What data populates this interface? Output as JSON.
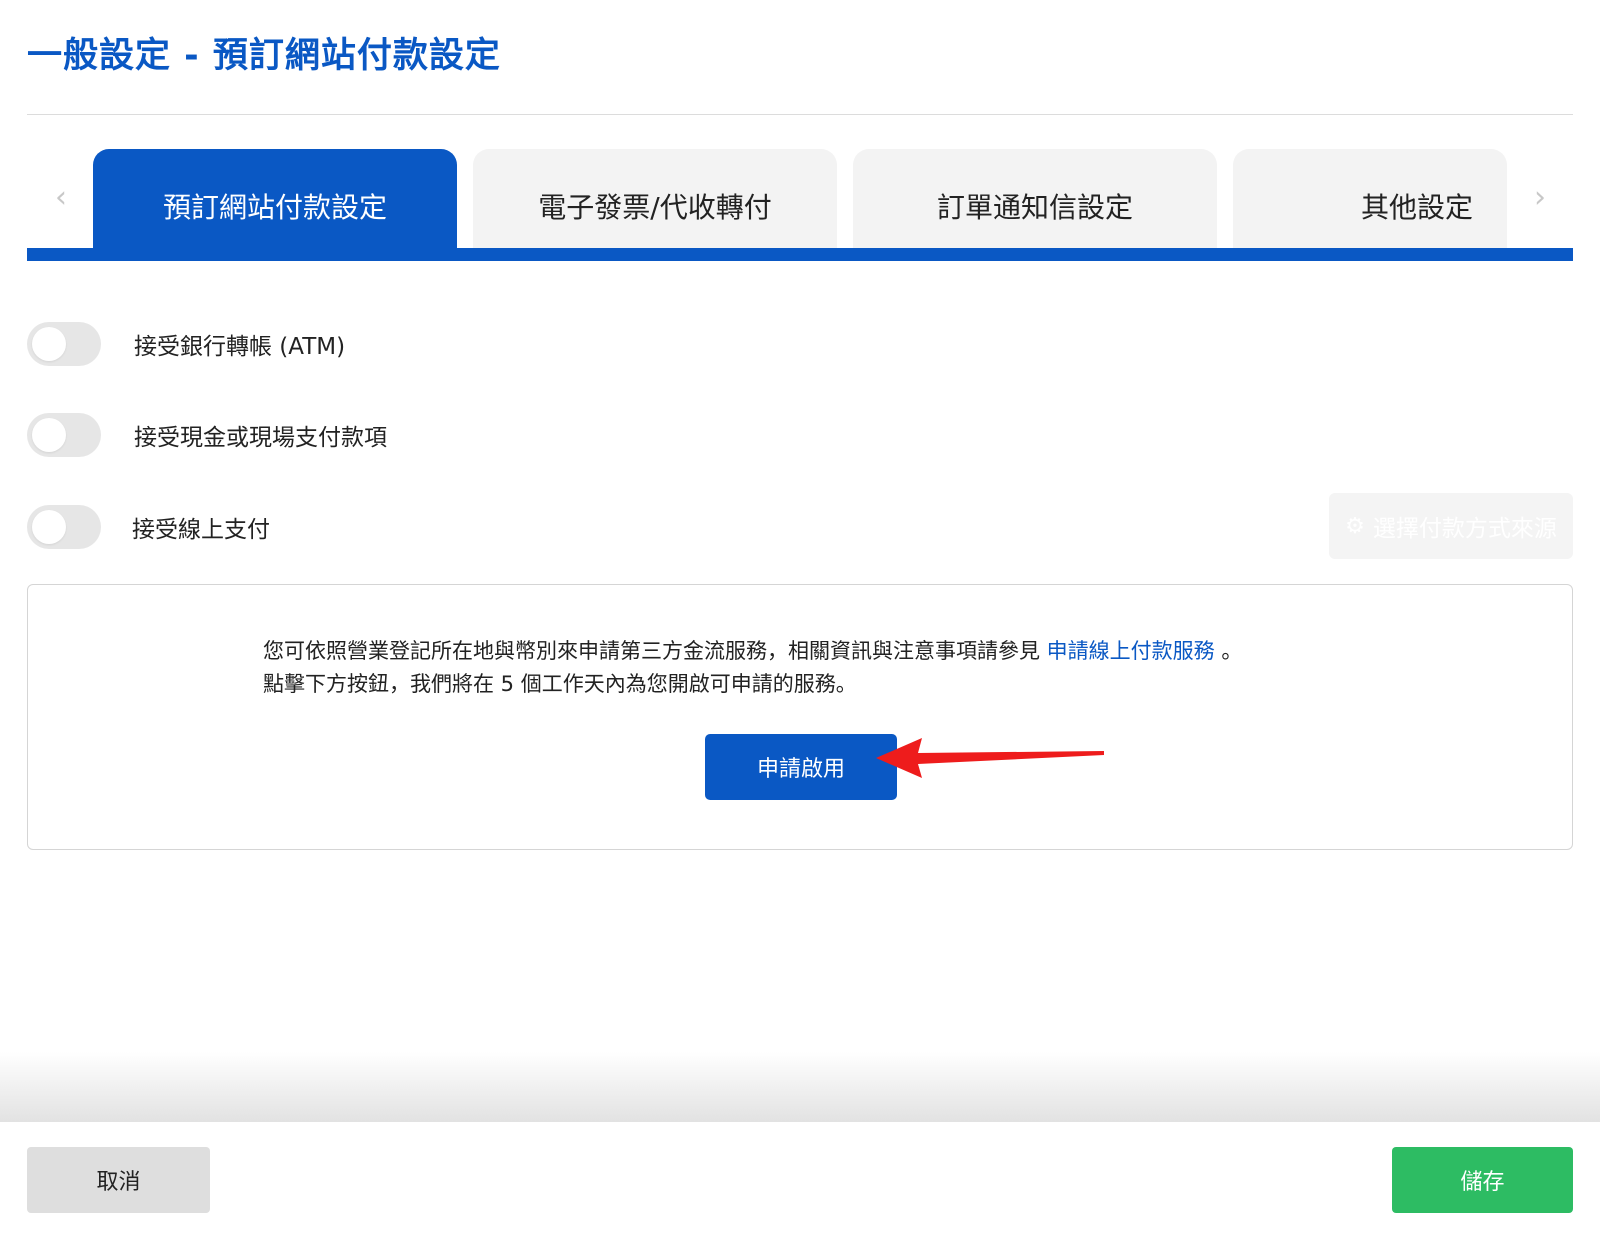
{
  "header": {
    "title": "一般設定 - 預訂網站付款設定"
  },
  "tabs": [
    {
      "label": "預訂網站付款設定",
      "active": true
    },
    {
      "label": "電子發票/代收轉付",
      "active": false
    },
    {
      "label": "訂單通知信設定",
      "active": false
    },
    {
      "label": "其他設定",
      "active": false
    }
  ],
  "tab_nav": {
    "prev_icon": "chevron-left-icon",
    "next_icon": "chevron-right-icon",
    "prev_glyph": "‹",
    "next_glyph": "›"
  },
  "toggles": [
    {
      "label": "接受銀行轉帳 (ATM)",
      "enabled": false
    },
    {
      "label": "接受現金或現場支付款項",
      "enabled": false
    },
    {
      "label": "接受線上支付",
      "enabled": false
    }
  ],
  "source_button": {
    "icon": "gear-icon",
    "icon_glyph": "⚙",
    "label": "選擇付款方式來源",
    "disabled": true
  },
  "info": {
    "line1_prefix": "您可依照營業登記所在地與幣別來申請第三方金流服務，相關資訊與注意事項請參見 ",
    "link_text": "申請線上付款服務",
    "line1_suffix": " 。",
    "line2": "點擊下方按鈕，我們將在 5 個工作天內為您開啟可申請的服務。",
    "apply_label": "申請啟用"
  },
  "footer": {
    "cancel_label": "取消",
    "save_label": "儲存"
  },
  "colors": {
    "primary": "#0a58c4",
    "save": "#2dbc63",
    "cancel_bg": "#dedede",
    "annotation_arrow": "#ee1c1c"
  }
}
